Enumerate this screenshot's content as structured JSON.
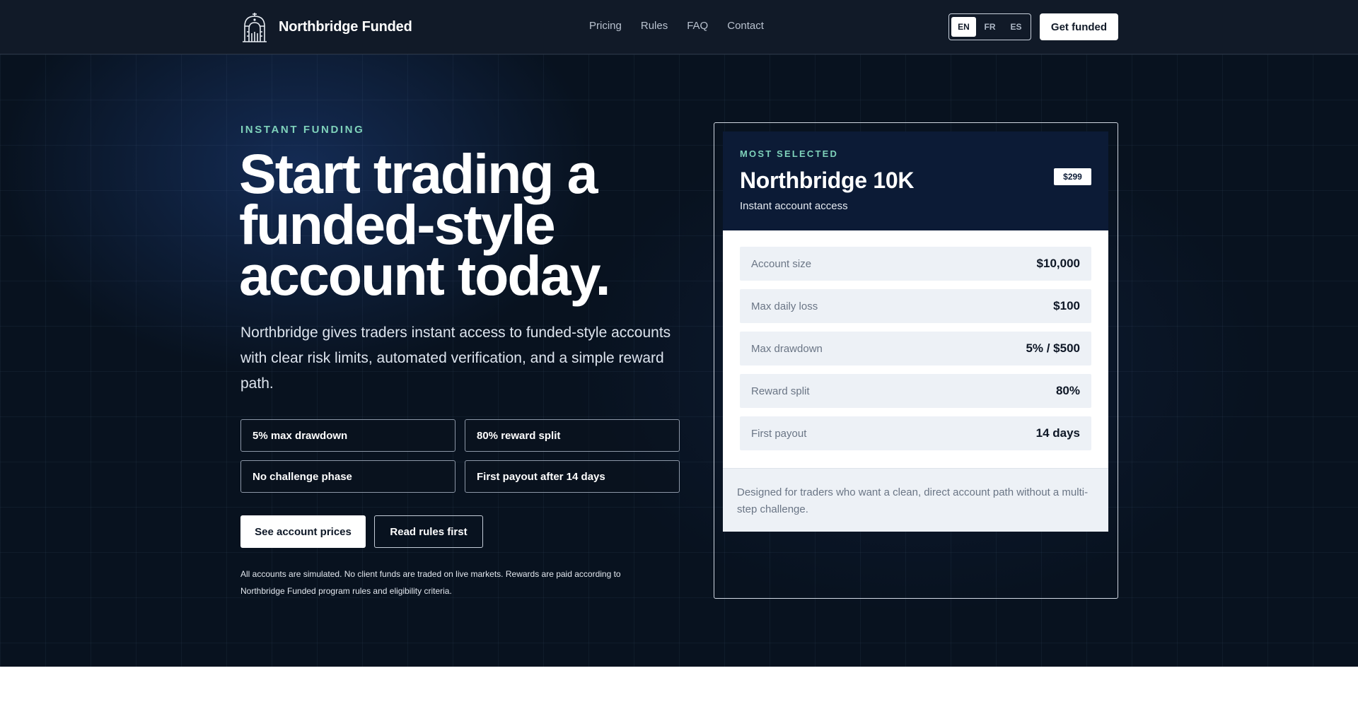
{
  "header": {
    "brand_name": "Northbridge Funded",
    "brand_icon": "gate-arch-icon",
    "nav": [
      "Pricing",
      "Rules",
      "FAQ",
      "Contact"
    ],
    "languages": [
      "EN",
      "FR",
      "ES"
    ],
    "active_language": "EN",
    "cta": "Get funded"
  },
  "hero": {
    "eyebrow": "INSTANT FUNDING",
    "headline_lines": [
      "Start trading a",
      "funded-style",
      "account today."
    ],
    "lede": "Northbridge gives traders instant access to funded-style accounts with clear risk limits, automated verification, and a simple reward path.",
    "features": [
      "5% max drawdown",
      "80% reward split",
      "No challenge phase",
      "First payout after 14 days"
    ],
    "primary_button": "See account prices",
    "secondary_button": "Read rules first",
    "disclaimer": "All accounts are simulated. No client funds are traded on live markets. Rewards are paid according to Northbridge Funded program rules and eligibility criteria."
  },
  "plan_card": {
    "eyebrow": "MOST SELECTED",
    "title": "Northbridge 10K",
    "subtitle": "Instant account access",
    "price": "$299",
    "specs": [
      {
        "label": "Account size",
        "value": "$10,000"
      },
      {
        "label": "Max daily loss",
        "value": "$100"
      },
      {
        "label": "Max drawdown",
        "value": "5% / $500"
      },
      {
        "label": "Reward split",
        "value": "80%"
      },
      {
        "label": "First payout",
        "value": "14 days"
      }
    ],
    "note": "Designed for traders who want a clean, direct account path without a multi-step challenge."
  },
  "colors": {
    "header_bg": "#111a28",
    "hero_bg": "#08121f",
    "accent_teal": "#7ed1ba",
    "card_head_bg": "#0c1b36",
    "spec_row_bg": "#edf1f6"
  }
}
